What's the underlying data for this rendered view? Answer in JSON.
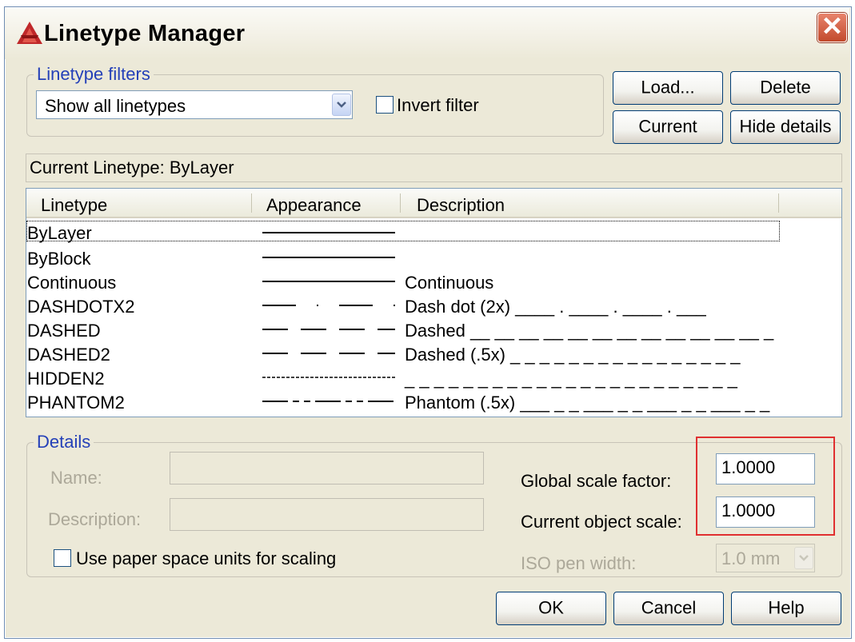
{
  "window": {
    "title": "Linetype Manager"
  },
  "filters": {
    "group_title": "Linetype filters",
    "dropdown_value": "Show all linetypes",
    "invert_label": "Invert filter"
  },
  "buttons": {
    "load": "Load...",
    "delete": "Delete",
    "current": "Current",
    "hide_details": "Hide details",
    "ok": "OK",
    "cancel": "Cancel",
    "help": "Help"
  },
  "current_linetype": "Current Linetype:  ByLayer",
  "list": {
    "columns": [
      "Linetype",
      "Appearance",
      "Description"
    ],
    "rows": [
      {
        "name": "ByLayer",
        "description": "",
        "pattern": "solid"
      },
      {
        "name": "ByBlock",
        "description": "",
        "pattern": "solid"
      },
      {
        "name": "Continuous",
        "description": "Continuous",
        "pattern": "solid"
      },
      {
        "name": "DASHDOTX2",
        "description": "Dash dot (2x) ____ . ____ . ____ . ___",
        "pattern": "dashdot"
      },
      {
        "name": "DASHED",
        "description": "Dashed __ __ __ __ __ __ __ __ __ __ __ __ _",
        "pattern": "dashed"
      },
      {
        "name": "DASHED2",
        "description": "Dashed (.5x) _ _ _ _ _ _ _ _ _ _ _ _ _ _ _ _",
        "pattern": "dashed"
      },
      {
        "name": "HIDDEN2",
        "description": "_ _ _ _ _ _ _ _ _ _ _ _ _ _ _ _ _ _ _ _ _ _ _",
        "pattern": "hidden"
      },
      {
        "name": "PHANTOM2",
        "description": "Phantom (.5x) ___ _ _ ___ _ _ ___ _ _ ___ _ _",
        "pattern": "phantom"
      }
    ]
  },
  "details": {
    "group_title": "Details",
    "name_label": "Name:",
    "description_label": "Description:",
    "paper_space_label": "Use paper space units for scaling",
    "global_scale_label": "Global scale factor:",
    "global_scale_value": "1.0000",
    "object_scale_label": "Current object scale:",
    "object_scale_value": "1.0000",
    "iso_pen_label": "ISO pen width:",
    "iso_pen_value": "1.0 mm"
  },
  "colors": {
    "highlight_box": "#e03030",
    "group_title": "#2440b8",
    "dialog_bg": "#ece9d8"
  },
  "icons": [
    "autocad-app-icon",
    "close-icon",
    "chevron-down-icon",
    "checkbox-icon"
  ]
}
